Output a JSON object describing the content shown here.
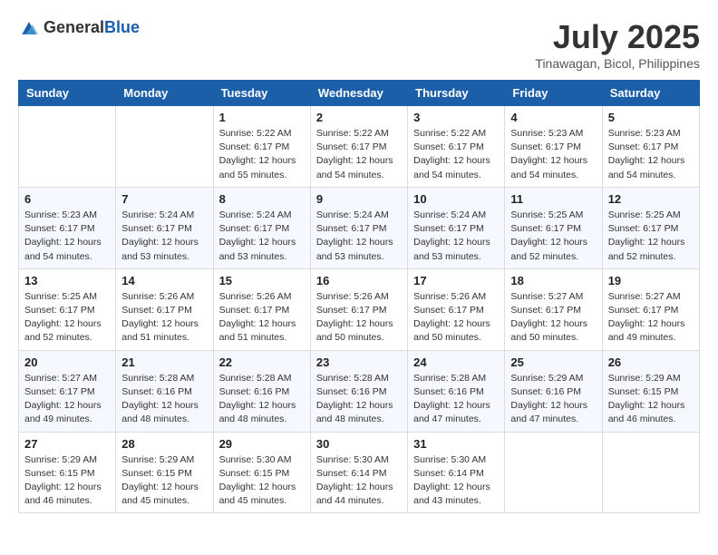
{
  "header": {
    "logo": {
      "general": "General",
      "blue": "Blue"
    },
    "month_year": "July 2025",
    "location": "Tinawagan, Bicol, Philippines"
  },
  "weekdays": [
    "Sunday",
    "Monday",
    "Tuesday",
    "Wednesday",
    "Thursday",
    "Friday",
    "Saturday"
  ],
  "weeks": [
    [
      {
        "day": "",
        "info": ""
      },
      {
        "day": "",
        "info": ""
      },
      {
        "day": "1",
        "info": "Sunrise: 5:22 AM\nSunset: 6:17 PM\nDaylight: 12 hours and 55 minutes."
      },
      {
        "day": "2",
        "info": "Sunrise: 5:22 AM\nSunset: 6:17 PM\nDaylight: 12 hours and 54 minutes."
      },
      {
        "day": "3",
        "info": "Sunrise: 5:22 AM\nSunset: 6:17 PM\nDaylight: 12 hours and 54 minutes."
      },
      {
        "day": "4",
        "info": "Sunrise: 5:23 AM\nSunset: 6:17 PM\nDaylight: 12 hours and 54 minutes."
      },
      {
        "day": "5",
        "info": "Sunrise: 5:23 AM\nSunset: 6:17 PM\nDaylight: 12 hours and 54 minutes."
      }
    ],
    [
      {
        "day": "6",
        "info": "Sunrise: 5:23 AM\nSunset: 6:17 PM\nDaylight: 12 hours and 54 minutes."
      },
      {
        "day": "7",
        "info": "Sunrise: 5:24 AM\nSunset: 6:17 PM\nDaylight: 12 hours and 53 minutes."
      },
      {
        "day": "8",
        "info": "Sunrise: 5:24 AM\nSunset: 6:17 PM\nDaylight: 12 hours and 53 minutes."
      },
      {
        "day": "9",
        "info": "Sunrise: 5:24 AM\nSunset: 6:17 PM\nDaylight: 12 hours and 53 minutes."
      },
      {
        "day": "10",
        "info": "Sunrise: 5:24 AM\nSunset: 6:17 PM\nDaylight: 12 hours and 53 minutes."
      },
      {
        "day": "11",
        "info": "Sunrise: 5:25 AM\nSunset: 6:17 PM\nDaylight: 12 hours and 52 minutes."
      },
      {
        "day": "12",
        "info": "Sunrise: 5:25 AM\nSunset: 6:17 PM\nDaylight: 12 hours and 52 minutes."
      }
    ],
    [
      {
        "day": "13",
        "info": "Sunrise: 5:25 AM\nSunset: 6:17 PM\nDaylight: 12 hours and 52 minutes."
      },
      {
        "day": "14",
        "info": "Sunrise: 5:26 AM\nSunset: 6:17 PM\nDaylight: 12 hours and 51 minutes."
      },
      {
        "day": "15",
        "info": "Sunrise: 5:26 AM\nSunset: 6:17 PM\nDaylight: 12 hours and 51 minutes."
      },
      {
        "day": "16",
        "info": "Sunrise: 5:26 AM\nSunset: 6:17 PM\nDaylight: 12 hours and 50 minutes."
      },
      {
        "day": "17",
        "info": "Sunrise: 5:26 AM\nSunset: 6:17 PM\nDaylight: 12 hours and 50 minutes."
      },
      {
        "day": "18",
        "info": "Sunrise: 5:27 AM\nSunset: 6:17 PM\nDaylight: 12 hours and 50 minutes."
      },
      {
        "day": "19",
        "info": "Sunrise: 5:27 AM\nSunset: 6:17 PM\nDaylight: 12 hours and 49 minutes."
      }
    ],
    [
      {
        "day": "20",
        "info": "Sunrise: 5:27 AM\nSunset: 6:17 PM\nDaylight: 12 hours and 49 minutes."
      },
      {
        "day": "21",
        "info": "Sunrise: 5:28 AM\nSunset: 6:16 PM\nDaylight: 12 hours and 48 minutes."
      },
      {
        "day": "22",
        "info": "Sunrise: 5:28 AM\nSunset: 6:16 PM\nDaylight: 12 hours and 48 minutes."
      },
      {
        "day": "23",
        "info": "Sunrise: 5:28 AM\nSunset: 6:16 PM\nDaylight: 12 hours and 48 minutes."
      },
      {
        "day": "24",
        "info": "Sunrise: 5:28 AM\nSunset: 6:16 PM\nDaylight: 12 hours and 47 minutes."
      },
      {
        "day": "25",
        "info": "Sunrise: 5:29 AM\nSunset: 6:16 PM\nDaylight: 12 hours and 47 minutes."
      },
      {
        "day": "26",
        "info": "Sunrise: 5:29 AM\nSunset: 6:15 PM\nDaylight: 12 hours and 46 minutes."
      }
    ],
    [
      {
        "day": "27",
        "info": "Sunrise: 5:29 AM\nSunset: 6:15 PM\nDaylight: 12 hours and 46 minutes."
      },
      {
        "day": "28",
        "info": "Sunrise: 5:29 AM\nSunset: 6:15 PM\nDaylight: 12 hours and 45 minutes."
      },
      {
        "day": "29",
        "info": "Sunrise: 5:30 AM\nSunset: 6:15 PM\nDaylight: 12 hours and 45 minutes."
      },
      {
        "day": "30",
        "info": "Sunrise: 5:30 AM\nSunset: 6:14 PM\nDaylight: 12 hours and 44 minutes."
      },
      {
        "day": "31",
        "info": "Sunrise: 5:30 AM\nSunset: 6:14 PM\nDaylight: 12 hours and 43 minutes."
      },
      {
        "day": "",
        "info": ""
      },
      {
        "day": "",
        "info": ""
      }
    ]
  ]
}
